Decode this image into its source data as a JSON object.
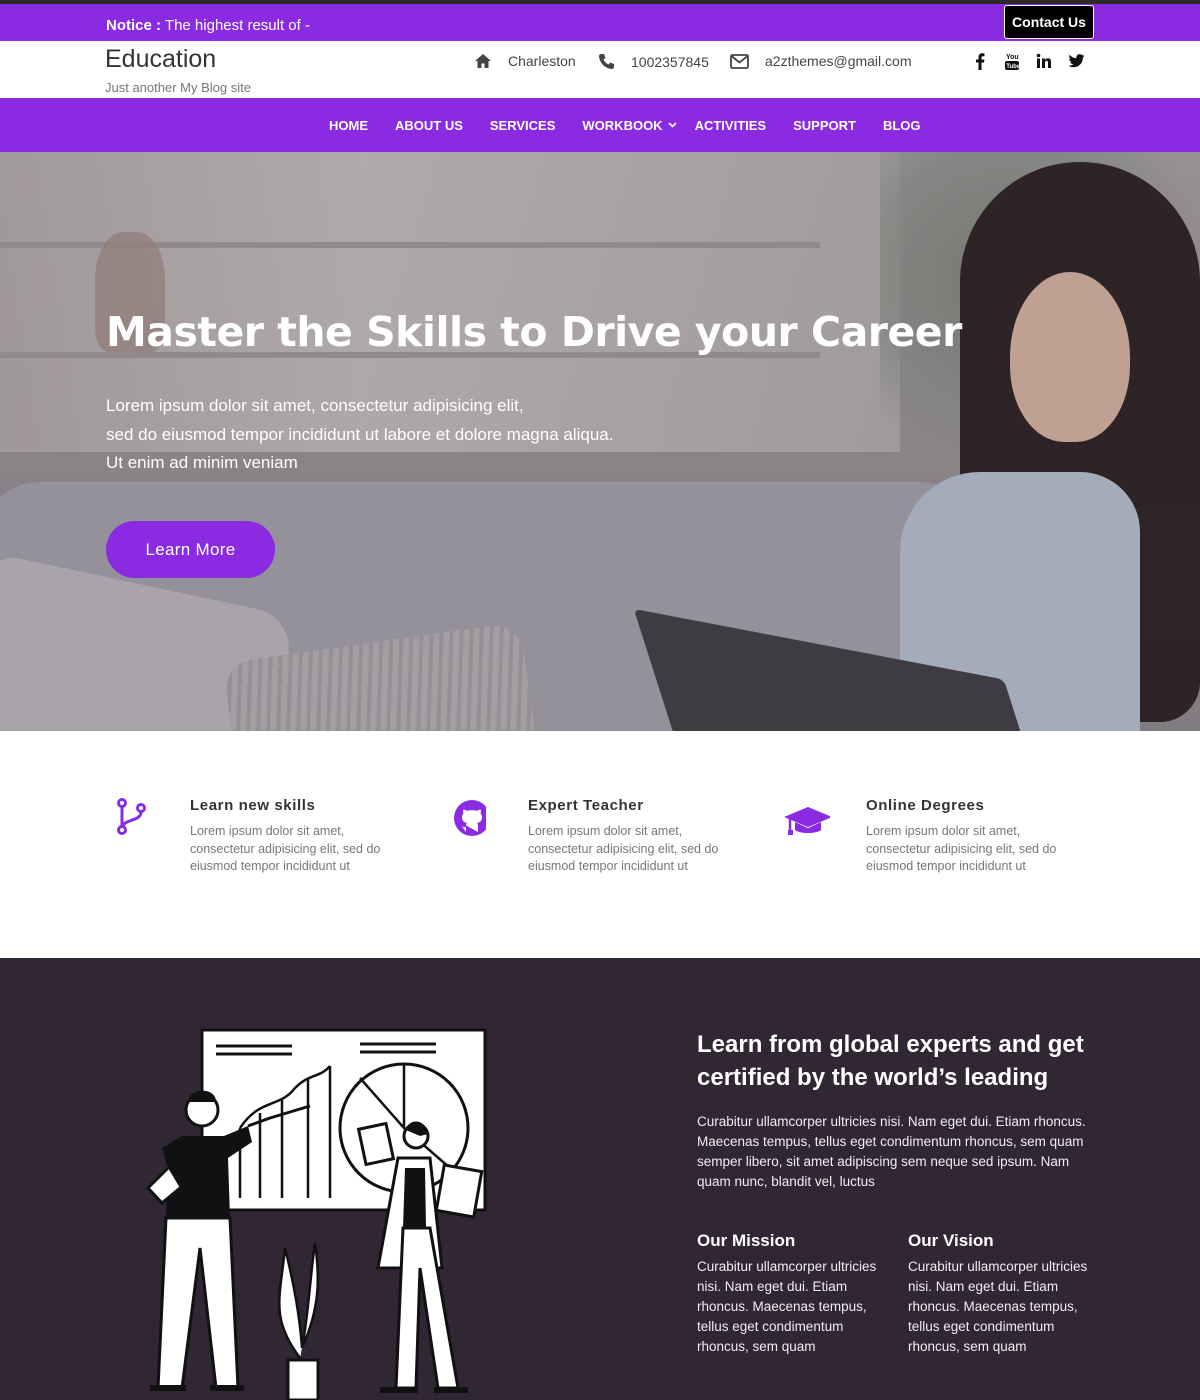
{
  "notice": {
    "label": "Notice :",
    "text": " The highest result of -",
    "contact_button": "Contact Us"
  },
  "header": {
    "site_title": "Education",
    "tagline": "Just another My Blog site",
    "location": "Charleston",
    "phone": "1002357845",
    "email": "a2zthemes@gmail.com",
    "social_icons": [
      "facebook-icon",
      "youtube-icon",
      "linkedin-icon",
      "twitter-icon"
    ]
  },
  "nav": {
    "items": [
      {
        "label": "HOME"
      },
      {
        "label": "ABOUT US"
      },
      {
        "label": "SERVICES"
      },
      {
        "label": "WORKBOOK",
        "has_dropdown": true
      },
      {
        "label": "ACTIVITIES"
      },
      {
        "label": "SUPPORT"
      },
      {
        "label": "BLOG"
      }
    ]
  },
  "hero": {
    "title": "Master the Skills to Drive your Career",
    "lines": [
      "Lorem ipsum dolor sit amet, consectetur adipisicing elit,",
      "sed do eiusmod tempor incididunt ut labore et dolore magna aliqua.",
      "Ut enim ad minim veniam"
    ],
    "button": "Learn More"
  },
  "features": [
    {
      "icon": "branch-icon",
      "title": "Learn new skills",
      "desc": "Lorem ipsum dolor sit amet, consectetur adipisicing elit, sed do eiusmod tempor incididunt ut"
    },
    {
      "icon": "github-icon",
      "title": "Expert Teacher",
      "desc": "Lorem ipsum dolor sit amet, consectetur adipisicing elit, sed do eiusmod tempor incididunt ut"
    },
    {
      "icon": "graduation-cap-icon",
      "title": "Online Degrees",
      "desc": "Lorem ipsum dolor sit amet, consectetur adipisicing elit, sed do eiusmod tempor incididunt ut"
    }
  ],
  "about": {
    "title": "Learn from global experts and get certified by the world’s leading",
    "text": "Curabitur ullamcorper ultricies nisi. Nam eget dui. Etiam rhoncus. Maecenas tempus, tellus eget condimentum rhoncus, sem quam semper libero, sit amet adipiscing sem neque sed ipsum. Nam quam nunc, blandit vel, luctus",
    "mission_title": "Our Mission",
    "mission_text": "Curabitur ullamcorper ultricies nisi. Nam eget dui. Etiam rhoncus. Maecenas tempus, tellus eget condimentum rhoncus, sem quam",
    "vision_title": "Our Vision",
    "vision_text": "Curabitur ullamcorper ultricies nisi. Nam eget dui. Etiam rhoncus. Maecenas tempus, tellus eget condimentum rhoncus, sem quam"
  },
  "colors": {
    "accent": "#8a2be2",
    "dark_section": "#302634",
    "topline": "#2b2b2b"
  }
}
